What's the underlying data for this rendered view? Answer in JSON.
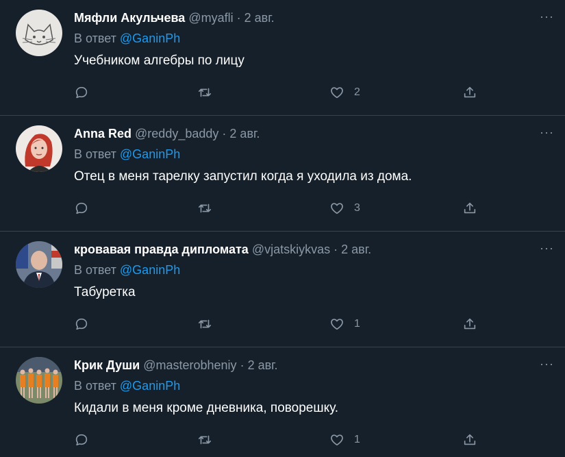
{
  "reply_prefix": "В ответ",
  "more_label": "···",
  "tweets": [
    {
      "name": "Мяфли Акульчева",
      "handle": "@myafli",
      "sep": "·",
      "date": "2 авг.",
      "reply_to": "@GaninPh",
      "text": "Учебником алгебры по лицу",
      "likes": "2"
    },
    {
      "name": "Anna Red",
      "handle": "@reddy_baddy",
      "sep": "·",
      "date": "2 авг.",
      "reply_to": "@GaninPh",
      "text": "Отец в меня тарелку запустил когда я уходила из дома.",
      "likes": "3"
    },
    {
      "name": "кровавая правда дипломата",
      "handle": "@vjatskiykvas",
      "sep": "·",
      "date": "2 авг.",
      "reply_to": "@GaninPh",
      "text": "Табуретка",
      "likes": "1"
    },
    {
      "name": "Крик Души",
      "handle": "@masterobheniy",
      "sep": "·",
      "date": "2 авг.",
      "reply_to": "@GaninPh",
      "text": "Кидали в меня кроме дневника, поворешку.",
      "likes": "1"
    }
  ],
  "colors": {
    "background": "#15202b",
    "divider": "#38444d",
    "secondary_text": "#8b98a5",
    "mention": "#1d9bf0"
  }
}
